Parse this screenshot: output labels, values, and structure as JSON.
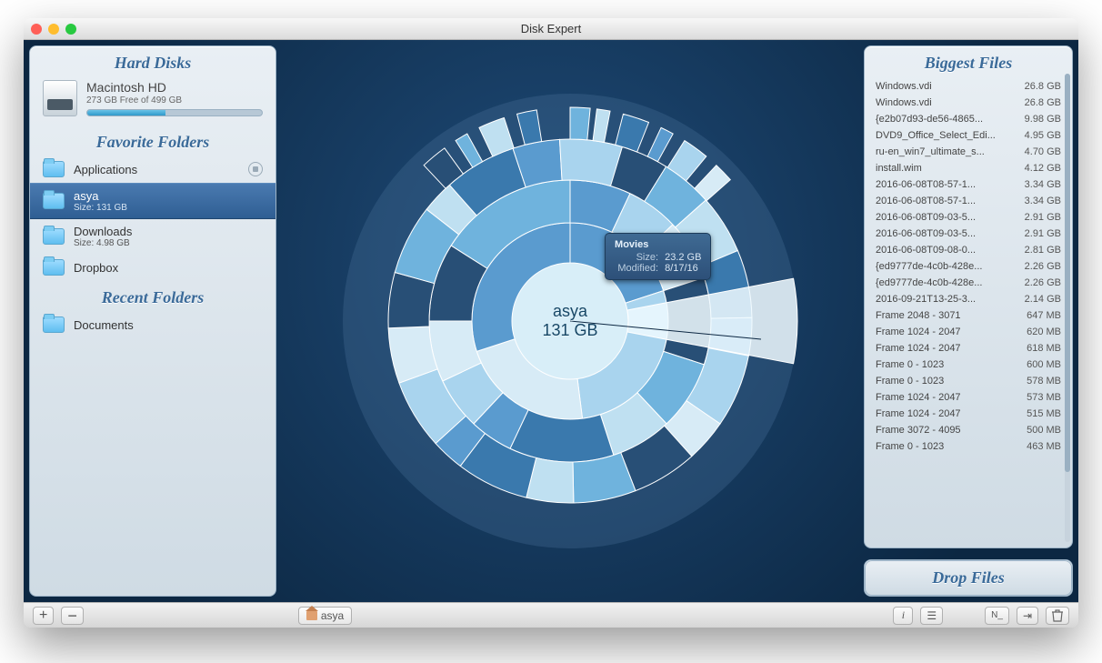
{
  "window": {
    "title": "Disk Expert"
  },
  "sections": {
    "hard_disks": "Hard Disks",
    "favorites": "Favorite Folders",
    "recent": "Recent Folders",
    "biggest": "Biggest Files",
    "drop": "Drop Files"
  },
  "disk": {
    "name": "Macintosh HD",
    "free_label": "273 GB Free of 499 GB",
    "used_fraction": 0.45
  },
  "favorites": [
    {
      "name": "Applications",
      "sub": "",
      "selected": false,
      "has_stop": true
    },
    {
      "name": "asya",
      "sub": "Size: 131 GB",
      "selected": true,
      "has_stop": false
    },
    {
      "name": "Downloads",
      "sub": "Size: 4.98 GB",
      "selected": false,
      "has_stop": false
    },
    {
      "name": "Dropbox",
      "sub": "",
      "selected": false,
      "has_stop": false
    }
  ],
  "recent": [
    {
      "name": "Documents",
      "sub": ""
    }
  ],
  "center": {
    "label_name": "asya",
    "label_size": "131 GB",
    "tooltip": {
      "name": "Movies",
      "size_label": "Size:",
      "size_value": "23.2 GB",
      "mod_label": "Modified:",
      "mod_value": "8/17/16"
    }
  },
  "biggest_files": [
    {
      "name": "Windows.vdi",
      "size": "26.8 GB"
    },
    {
      "name": "Windows.vdi",
      "size": "26.8 GB"
    },
    {
      "name": "{e2b07d93-de56-4865...",
      "size": "9.98 GB"
    },
    {
      "name": "DVD9_Office_Select_Edi...",
      "size": "4.95 GB"
    },
    {
      "name": "ru-en_win7_ultimate_s...",
      "size": "4.70 GB"
    },
    {
      "name": "install.wim",
      "size": "4.12 GB"
    },
    {
      "name": "2016-06-08T08-57-1...",
      "size": "3.34 GB"
    },
    {
      "name": "2016-06-08T08-57-1...",
      "size": "3.34 GB"
    },
    {
      "name": "2016-06-08T09-03-5...",
      "size": "2.91 GB"
    },
    {
      "name": "2016-06-08T09-03-5...",
      "size": "2.91 GB"
    },
    {
      "name": "2016-06-08T09-08-0...",
      "size": "2.81 GB"
    },
    {
      "name": "{ed9777de-4c0b-428e...",
      "size": "2.26 GB"
    },
    {
      "name": "{ed9777de-4c0b-428e...",
      "size": "2.26 GB"
    },
    {
      "name": "2016-09-21T13-25-3...",
      "size": "2.14 GB"
    },
    {
      "name": "Frame 2048 - 3071",
      "size": "647 MB"
    },
    {
      "name": "Frame 1024 - 2047",
      "size": "620 MB"
    },
    {
      "name": "Frame 1024 - 2047",
      "size": "618 MB"
    },
    {
      "name": "Frame 0 - 1023",
      "size": "600 MB"
    },
    {
      "name": "Frame 0 - 1023",
      "size": "578 MB"
    },
    {
      "name": "Frame 1024 - 2047",
      "size": "573 MB"
    },
    {
      "name": "Frame 1024 - 2047",
      "size": "515 MB"
    },
    {
      "name": "Frame 3072 - 4095",
      "size": "500 MB"
    },
    {
      "name": "Frame 0 - 1023",
      "size": "463 MB"
    }
  ],
  "breadcrumb": {
    "label": "asya"
  },
  "chart_data": {
    "type": "sunburst",
    "center": {
      "name": "asya",
      "size_gb": 131
    },
    "note": "Sunburst shows folder hierarchy under 'asya'. Only hovered segment details are visible.",
    "highlighted_segment": {
      "name": "Movies",
      "size_gb": 23.2,
      "modified": "8/17/16"
    }
  },
  "colors": {
    "accent": "#3a6a99",
    "ring_dark": "#284f76",
    "ring_mid": "#5a9bcf",
    "ring_light": "#a9d4ee",
    "ring_pale": "#d7ebf6"
  }
}
